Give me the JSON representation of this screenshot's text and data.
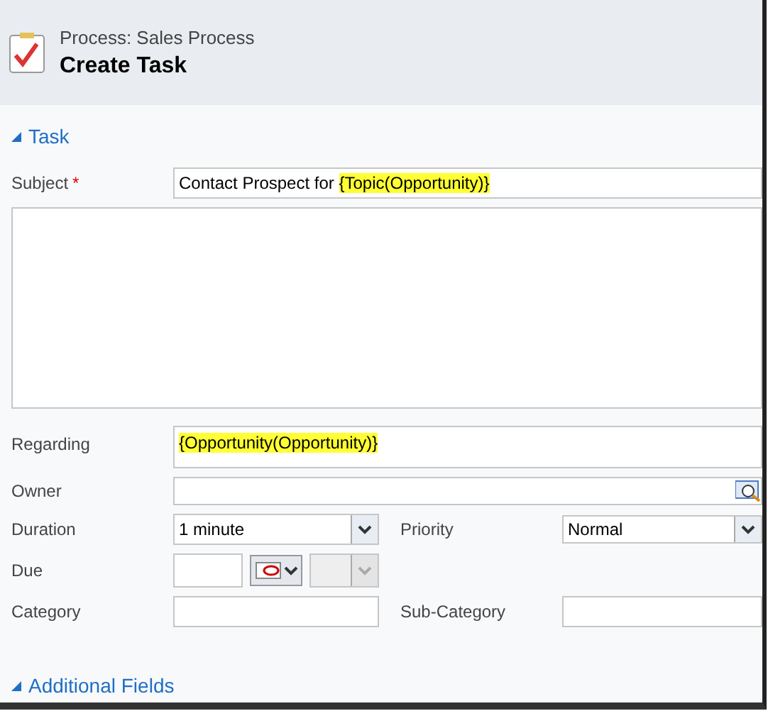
{
  "header": {
    "process": "Process: Sales Process",
    "title": "Create Task"
  },
  "section": {
    "label": "Task",
    "expanded": true
  },
  "subject": {
    "label": "Subject",
    "required": true,
    "required_mark": "*",
    "text": "Contact Prospect for ",
    "token": "{Topic(Opportunity)}"
  },
  "regarding": {
    "label": "Regarding",
    "token": "{Opportunity(Opportunity)}"
  },
  "owner": {
    "label": "Owner"
  },
  "duration": {
    "label": "Duration",
    "value": "1 minute"
  },
  "priority": {
    "label": "Priority",
    "value": "Normal"
  },
  "due": {
    "label": "Due",
    "time_disabled": true
  },
  "category": {
    "label": "Category"
  },
  "sub_category": {
    "label": "Sub-Category"
  },
  "next_section": {
    "label": "Additional Fields",
    "expanded": true
  }
}
